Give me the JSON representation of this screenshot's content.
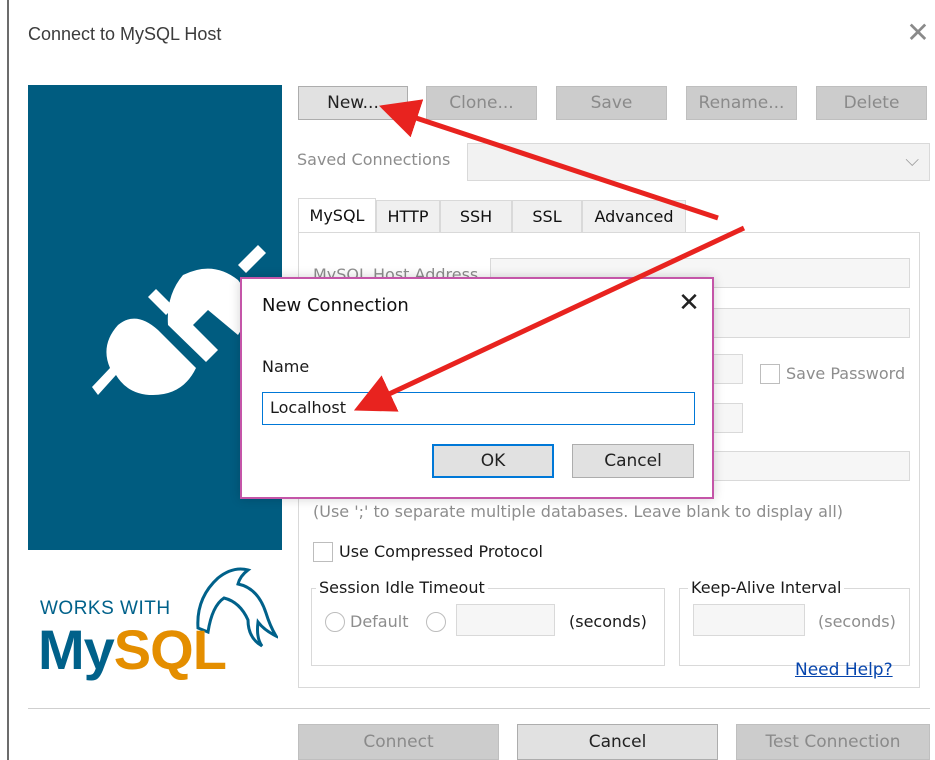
{
  "window": {
    "title": "Connect to MySQL Host"
  },
  "branding": {
    "works_with": "WORKS WITH",
    "mysql_my": "My",
    "mysql_sql": "SQL"
  },
  "toolbar": {
    "new_label": "New...",
    "clone_label": "Clone...",
    "save_label": "Save",
    "rename_label": "Rename...",
    "delete_label": "Delete"
  },
  "saved_connections": {
    "label": "Saved Connections",
    "value": ""
  },
  "tabs": [
    {
      "label": "MySQL",
      "active": true
    },
    {
      "label": "HTTP"
    },
    {
      "label": "SSH"
    },
    {
      "label": "SSL"
    },
    {
      "label": "Advanced"
    }
  ],
  "mysql_tab": {
    "host_label": "MySQL Host Address",
    "save_password_label": "Save Password",
    "databases_hint": "(Use ';' to separate multiple databases. Leave blank to display all)",
    "compressed_label": "Use Compressed Protocol",
    "session_idle_title": "Session Idle Timeout",
    "default_label": "Default",
    "seconds_label": "(seconds)",
    "keepalive_title": "Keep-Alive Interval",
    "keepalive_seconds": "(seconds)",
    "help_link": "Need Help?"
  },
  "footer": {
    "connect_label": "Connect",
    "cancel_label": "Cancel",
    "test_label": "Test Connection"
  },
  "dialog": {
    "title": "New Connection",
    "name_label": "Name",
    "name_value": "Localhost",
    "ok_label": "OK",
    "cancel_label": "Cancel"
  },
  "colors": {
    "side_panel": "#005c80",
    "arrow": "#e8231f",
    "dialog_border": "#c455a8",
    "focus": "#0078d7"
  }
}
